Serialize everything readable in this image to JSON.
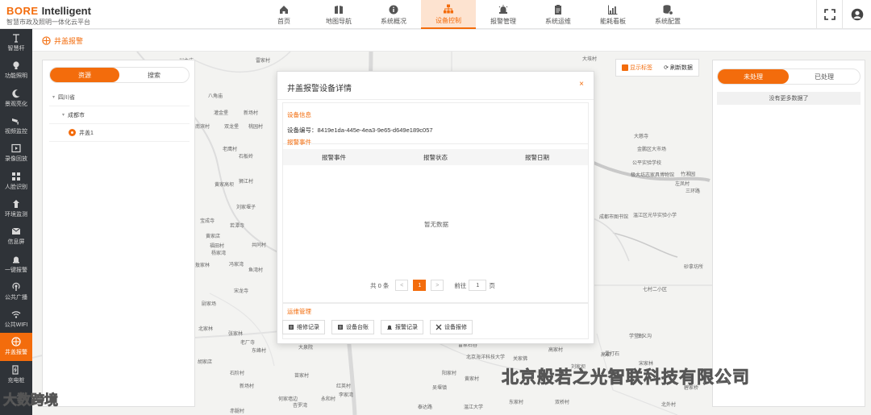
{
  "brand": {
    "name": "BORE",
    "name2": "Intelligent",
    "subtitle": "智慧市政及照明一体化云平台"
  },
  "nav": [
    {
      "label": "首页",
      "icon": "home-icon"
    },
    {
      "label": "地图导航",
      "icon": "map-book-icon"
    },
    {
      "label": "系统概况",
      "icon": "info-icon"
    },
    {
      "label": "设备控制",
      "icon": "device-tree-icon",
      "active": true
    },
    {
      "label": "报警管理",
      "icon": "alarm-icon"
    },
    {
      "label": "系统运维",
      "icon": "clipboard-icon"
    },
    {
      "label": "能耗看板",
      "icon": "chart-icon"
    },
    {
      "label": "系统配置",
      "icon": "config-icon"
    }
  ],
  "sidebar": [
    {
      "label": "智慧杆",
      "icon": "pole-icon"
    },
    {
      "label": "功能照明",
      "icon": "bulb-icon"
    },
    {
      "label": "景观亮化",
      "icon": "moon-icon"
    },
    {
      "label": "视频监控",
      "icon": "camera-icon"
    },
    {
      "label": "录像回放",
      "icon": "film-icon"
    },
    {
      "label": "人脸识别",
      "icon": "face-grid-icon"
    },
    {
      "label": "环境监测",
      "icon": "env-icon"
    },
    {
      "label": "信息屏",
      "icon": "message-icon"
    },
    {
      "label": "一键报警",
      "icon": "bell-icon"
    },
    {
      "label": "公共广播",
      "icon": "broadcast-icon"
    },
    {
      "label": "公共WIFI",
      "icon": "wifi-icon"
    },
    {
      "label": "井盖报警",
      "icon": "manhole-icon",
      "active": true
    },
    {
      "label": "充电桩",
      "icon": "charger-icon"
    }
  ],
  "subbar": {
    "title": "井盖报警"
  },
  "left_panel": {
    "tabs": [
      "资源",
      "搜索"
    ],
    "tree": [
      {
        "label": "四川省",
        "level": 0
      },
      {
        "label": "成都市",
        "level": 1
      },
      {
        "label": "井盖1",
        "level": 2
      }
    ]
  },
  "map_tools": {
    "show_labels": "显示标签",
    "refresh": "刷新数据"
  },
  "right_panel": {
    "tabs": [
      "未处理",
      "已处理"
    ],
    "no_more": "没有更多数据了"
  },
  "dialog": {
    "title": "井盖报警设备详情",
    "close": "×",
    "device_info_title": "设备信息",
    "device_no": "设备编号：8419e1da-445e-4ea3-9e65-d649e189c057",
    "alarm_events_title": "报警事件",
    "columns": [
      "报警事件",
      "报警状态",
      "报警日期"
    ],
    "empty": "暂无数据",
    "pager": {
      "total": "共 0 条",
      "prev": "<",
      "page": "1",
      "next": ">",
      "goto": "前往",
      "goto_value": "1",
      "unit": "页"
    },
    "ops_title": "运维管理",
    "ops": [
      {
        "label": "维修记录",
        "icon": "repair-icon"
      },
      {
        "label": "设备台账",
        "icon": "ledger-icon"
      },
      {
        "label": "报警记录",
        "icon": "bell-icon"
      },
      {
        "label": "设备报修",
        "icon": "tools-icon"
      }
    ]
  },
  "map_labels": [
    "川主庙",
    "雷家村",
    "八角庙",
    "灌金堡",
    "新场村",
    "南滨村",
    "双龙堡",
    "桃园村",
    "老鹰村",
    "石板岭",
    "黄家高坝",
    "狮江村",
    "刘家堰子",
    "宝成寺",
    "若潭寺",
    "黄家店",
    "福田村",
    "共同村",
    "杨家湾",
    "敖家林",
    "冯家湾",
    "鱼湾村",
    "宋龙寺",
    "尉家场",
    "北家林",
    "张家林",
    "老厂寺",
    "东峰村",
    "大泉院",
    "胡家店",
    "石阶村",
    "新场村",
    "苗家村",
    "红英村",
    "何家墙边",
    "永和村",
    "李家湾",
    "杏罗湾",
    "赤腿村",
    "大垓村",
    "学堂村",
    "雷打石",
    "七村二小区",
    "三义沟",
    "宋家林",
    "大慈寺",
    "金鹏区大市场",
    "公平实验学校",
    "极大坊志家具博物馆",
    "竹湘园",
    "左凤村",
    "三环路",
    "成都市图书馆",
    "温江区光华实验小学",
    "高坝",
    "砂拿坊所",
    "北京海洋科技大学",
    "雷家石谷",
    "阳家村",
    "黄家村",
    "吴堰镇",
    "关家佛",
    "刘家坝",
    "高家村",
    "泰达路",
    "东家村",
    "双桥村",
    "北外村",
    "碧家桥",
    "温江大学"
  ],
  "watermark": "北京般若之光智联科技有限公司",
  "watermark2": "大数跨境"
}
